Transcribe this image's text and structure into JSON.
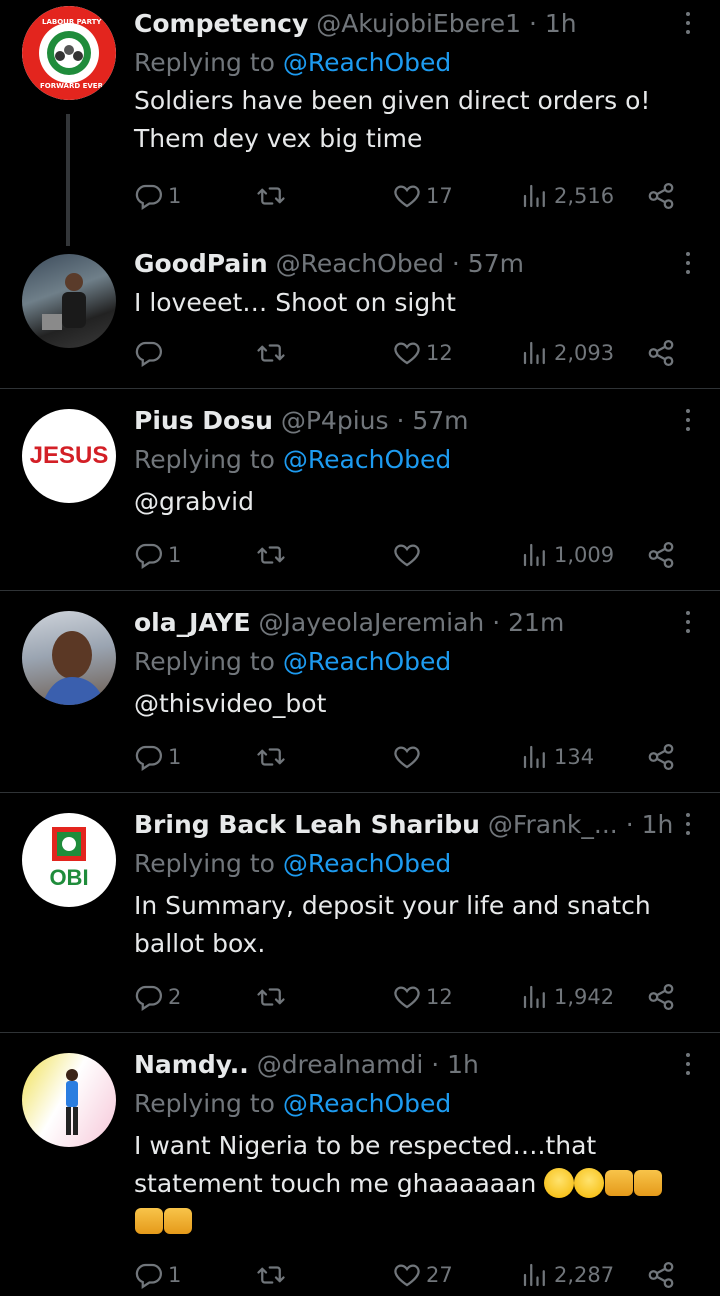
{
  "tweets": [
    {
      "name": "Competency",
      "handle": "@AkujobiEbere1",
      "time": "· 1h",
      "replying_label": "Replying to",
      "replying_to": "@ReachObed",
      "text_lines": [
        "Soldiers have been given direct orders o!",
        "Them dey vex big time"
      ],
      "replies": "1",
      "retweets": "",
      "likes": "17",
      "views": "2,516",
      "avatar": "labour-party-logo",
      "avatar_text": [
        "LABOUR PARTY",
        "FORWARD EVER"
      ]
    },
    {
      "name": "GoodPain",
      "handle": "@ReachObed",
      "time": "· 57m",
      "text_lines": [
        "I loveeet… Shoot on sight"
      ],
      "replies": "",
      "retweets": "",
      "likes": "12",
      "views": "2,093",
      "avatar": "man-photo"
    },
    {
      "name": "Pius Dosu",
      "handle": "@P4pius",
      "time": "· 57m",
      "replying_label": "Replying to",
      "replying_to": "@ReachObed",
      "mention_line": "@grabvid",
      "replies": "1",
      "retweets": "",
      "likes": "",
      "views": "1,009",
      "avatar_text": "JESUS"
    },
    {
      "name": "ola_JAYE",
      "handle": "@JayeolaJeremiah",
      "time": "· 21m",
      "replying_label": "Replying to",
      "replying_to": "@ReachObed",
      "mention_line": "@thisvideo_bot",
      "replies": "1",
      "retweets": "",
      "likes": "",
      "views": "134",
      "avatar": "man-selfie"
    },
    {
      "name": "Bring Back Leah Sharibu",
      "handle": "@Frank_...",
      "time": "· 1h",
      "replying_label": "Replying to",
      "replying_to": "@ReachObed",
      "text_lines": [
        "In Summary, deposit your life and snatch",
        "ballot box."
      ],
      "replies": "2",
      "retweets": "",
      "likes": "12",
      "views": "1,942",
      "avatar_text": "OBI"
    },
    {
      "name": "Namdy..",
      "handle": "@drealnamdi",
      "time": "· 1h",
      "replying_label": "Replying to",
      "replying_to": "@ReachObed",
      "text_lines": [
        "I want Nigeria to be respected….that",
        "statement touch me ghaaaaaan"
      ],
      "replies": "1",
      "retweets": "",
      "likes": "27",
      "views": "2,287",
      "avatar": "man-standing-photo"
    }
  ],
  "colors": {
    "background": "#000000",
    "text": "#e7e9ea",
    "muted": "#71767b",
    "link": "#1d9bf0",
    "divider": "#2f3336"
  },
  "icons": [
    "reply-icon",
    "retweet-icon",
    "like-icon",
    "views-icon",
    "share-icon",
    "more-icon"
  ]
}
